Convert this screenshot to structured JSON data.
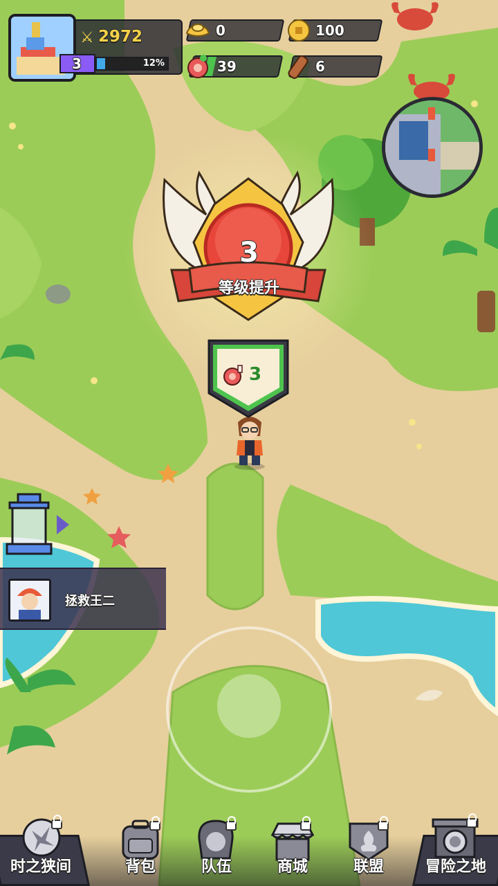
{
  "player": {
    "power": "2972",
    "level": "3",
    "exp_percent_text": "12%",
    "exp_fraction": 0.12
  },
  "resources": {
    "gold_ingot": "0",
    "coins": "100",
    "meat": "39",
    "wood": "6"
  },
  "level_up": {
    "level": "3",
    "title": "等级提升"
  },
  "reward": {
    "icon": "meat-icon",
    "amount": "3"
  },
  "quest": {
    "text": "拯救王二"
  },
  "nav": [
    {
      "label": "时之狭间",
      "icon": "time-rift-icon",
      "locked": true
    },
    {
      "label": "背包",
      "icon": "backpack-icon",
      "locked": true
    },
    {
      "label": "队伍",
      "icon": "team-icon",
      "locked": true
    },
    {
      "label": "商城",
      "icon": "shop-icon",
      "locked": true
    },
    {
      "label": "联盟",
      "icon": "alliance-icon",
      "locked": true
    },
    {
      "label": "冒险之地",
      "icon": "adventure-gate-icon",
      "locked": true
    }
  ],
  "colors": {
    "grass": "#9ccc58",
    "sand": "#e8d2a8",
    "water": "#4fc7d6",
    "badge_red": "#e8463a",
    "badge_gold": "#f5c542",
    "exp_bar": "#41a9e8",
    "level_purple": "#8a5cf5"
  }
}
